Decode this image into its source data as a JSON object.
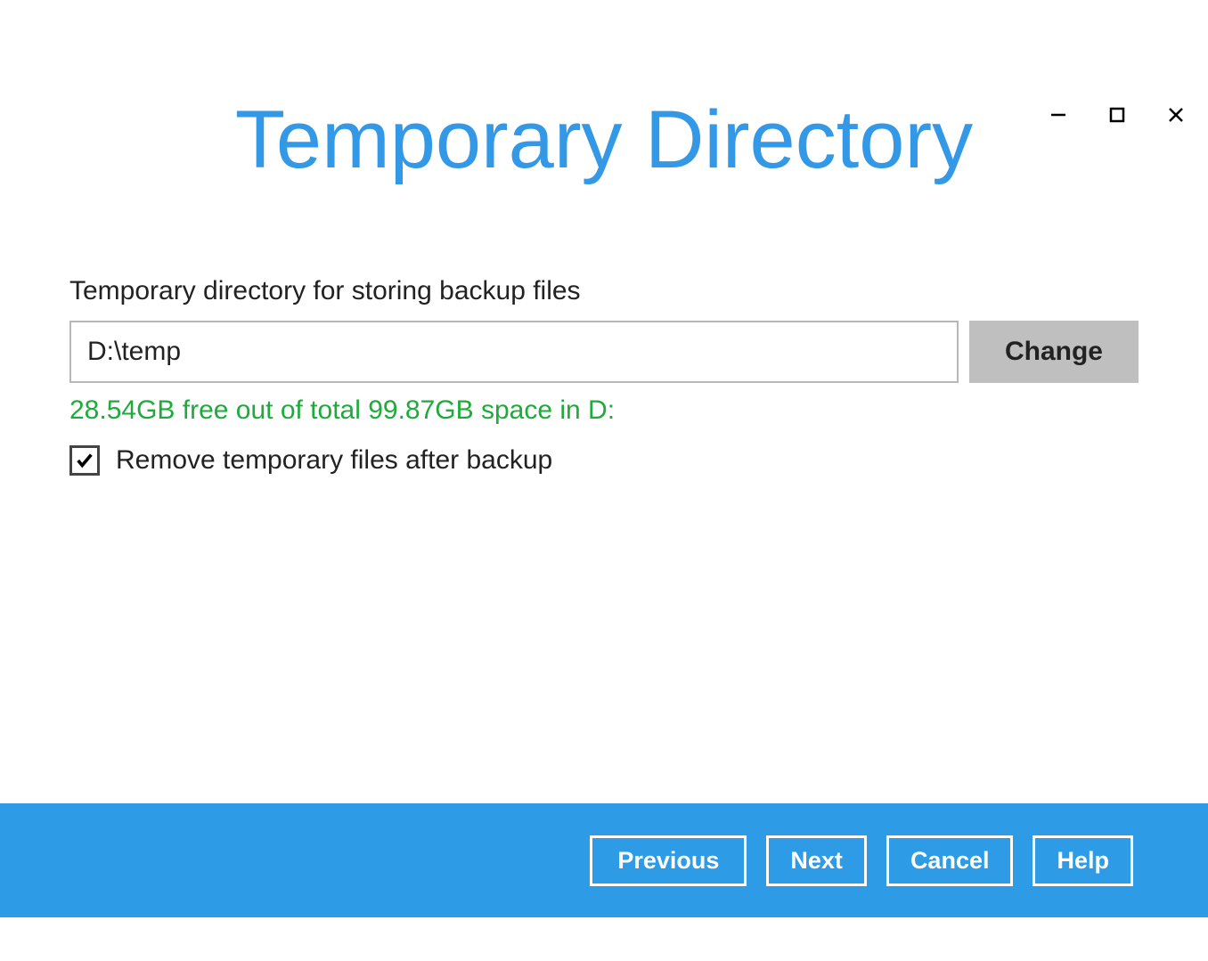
{
  "header": {
    "title": "Temporary Directory"
  },
  "main": {
    "field_label": "Temporary directory for storing backup files",
    "path_value": "D:\\temp",
    "change_label": "Change",
    "free_space_text": "28.54GB free out of total 99.87GB space in D:",
    "remove_temp_label": "Remove temporary files after backup",
    "remove_temp_checked": true
  },
  "footer": {
    "previous_label": "Previous",
    "next_label": "Next",
    "cancel_label": "Cancel",
    "help_label": "Help"
  }
}
